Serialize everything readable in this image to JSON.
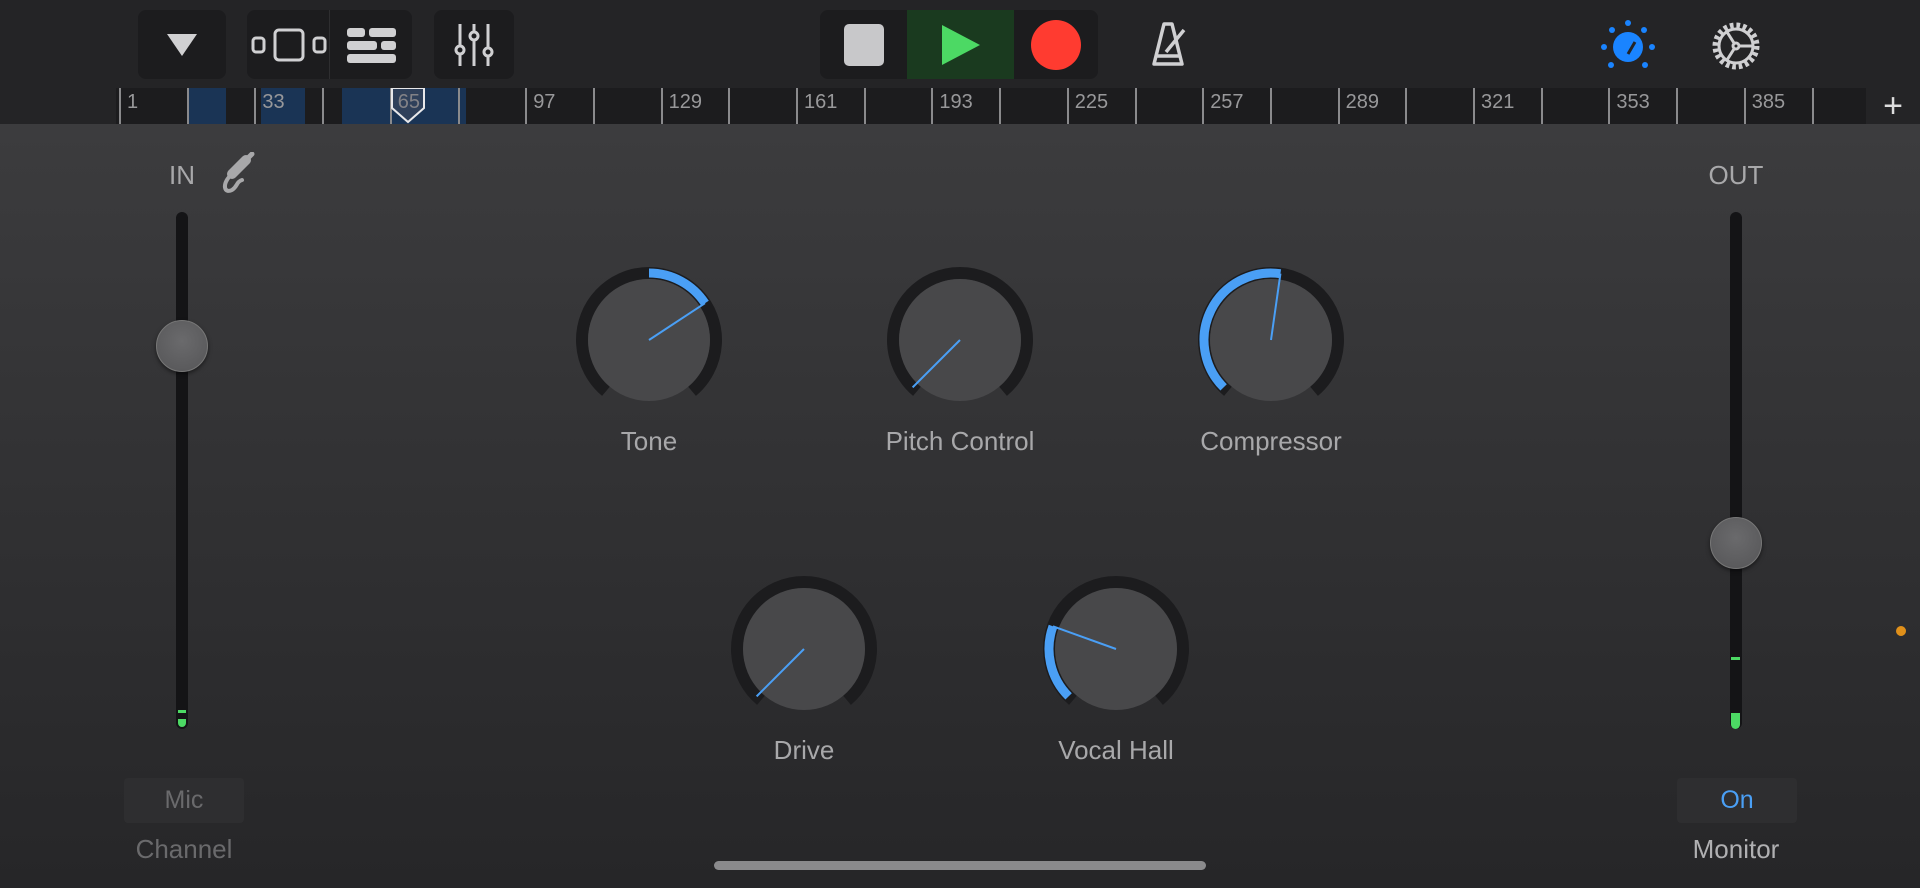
{
  "toolbar": {
    "browser_icon": "triangle-down-icon",
    "tracks_view_icon": "tracks-view-icon",
    "list_view_icon": "list-view-icon",
    "mixer_icon": "mixer-sliders-icon",
    "stop_icon": "stop-icon",
    "play_icon": "play-icon",
    "record_icon": "record-icon",
    "metronome_icon": "metronome-icon",
    "smart_controls_icon": "knob-icon",
    "settings_icon": "gear-icon"
  },
  "colors": {
    "accent": "#4a9ff5",
    "play": "#4cd964",
    "play_bg": "#1a3a1f",
    "record": "#ff3b30",
    "meter": "#4cd964",
    "region": "#1a3455",
    "orange_dot": "#e0901a"
  },
  "ruler": {
    "labels": [
      "1",
      "33",
      "65",
      "97",
      "129",
      "161",
      "193",
      "225",
      "257",
      "289",
      "321",
      "353",
      "385"
    ],
    "add_label": "+"
  },
  "input": {
    "label": "IN",
    "icon": "input-jack-icon",
    "level": 0.74,
    "button": "Mic",
    "caption": "Channel"
  },
  "output": {
    "label": "OUT",
    "level": 0.36,
    "button": "On",
    "caption": "Monitor"
  },
  "knobs": [
    {
      "label": "Tone",
      "value": 0.71,
      "bipolar": true
    },
    {
      "label": "Pitch Control",
      "value": 0.0,
      "bipolar": false
    },
    {
      "label": "Compressor",
      "value": 0.53,
      "bipolar": false
    },
    {
      "label": "Drive",
      "value": 0.0,
      "bipolar": false
    },
    {
      "label": "Vocal Hall",
      "value": 0.24,
      "bipolar": false
    }
  ]
}
